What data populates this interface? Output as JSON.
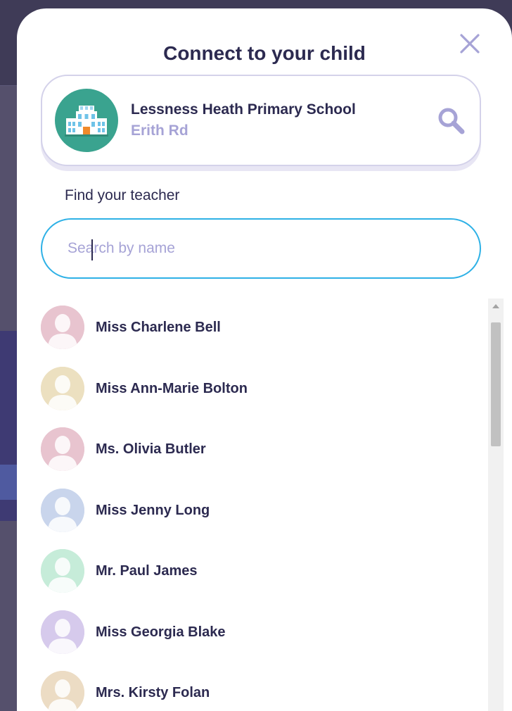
{
  "modal": {
    "title": "Connect to your child",
    "close_icon": "close-icon"
  },
  "school": {
    "name": "Lessness Heath Primary School",
    "address": "Erith Rd",
    "icon": "school-building-icon",
    "search_icon": "search-icon",
    "avatar_color": "#3aa38f"
  },
  "teacher_search": {
    "label": "Find your teacher",
    "placeholder": "Search by name",
    "value": ""
  },
  "teachers": [
    {
      "name": "Miss Charlene Bell",
      "avatar_color": "#e8c4cf"
    },
    {
      "name": "Miss Ann-Marie Bolton",
      "avatar_color": "#ece0c0"
    },
    {
      "name": "Ms. Olivia Butler",
      "avatar_color": "#e8c4cf"
    },
    {
      "name": "Miss Jenny Long",
      "avatar_color": "#c9d5ec"
    },
    {
      "name": "Mr. Paul James",
      "avatar_color": "#c6ecd9"
    },
    {
      "name": "Miss Georgia Blake",
      "avatar_color": "#d6caec"
    },
    {
      "name": "Mrs. Kirsty Folan",
      "avatar_color": "#ecdcc4"
    }
  ],
  "colors": {
    "accent": "#2eb1e6",
    "text_dark": "#2c2a50",
    "text_muted": "#a6a3d6"
  }
}
